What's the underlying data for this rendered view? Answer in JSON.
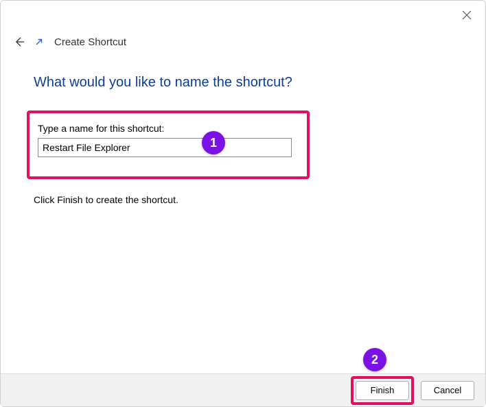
{
  "window": {
    "title": "Create Shortcut"
  },
  "heading": "What would you like to name the shortcut?",
  "field": {
    "label": "Type a name for this shortcut:",
    "value": "Restart File Explorer"
  },
  "hint": "Click Finish to create the shortcut.",
  "buttons": {
    "finish": "Finish",
    "cancel": "Cancel"
  },
  "annotations": {
    "callout1": "1",
    "callout2": "2"
  }
}
